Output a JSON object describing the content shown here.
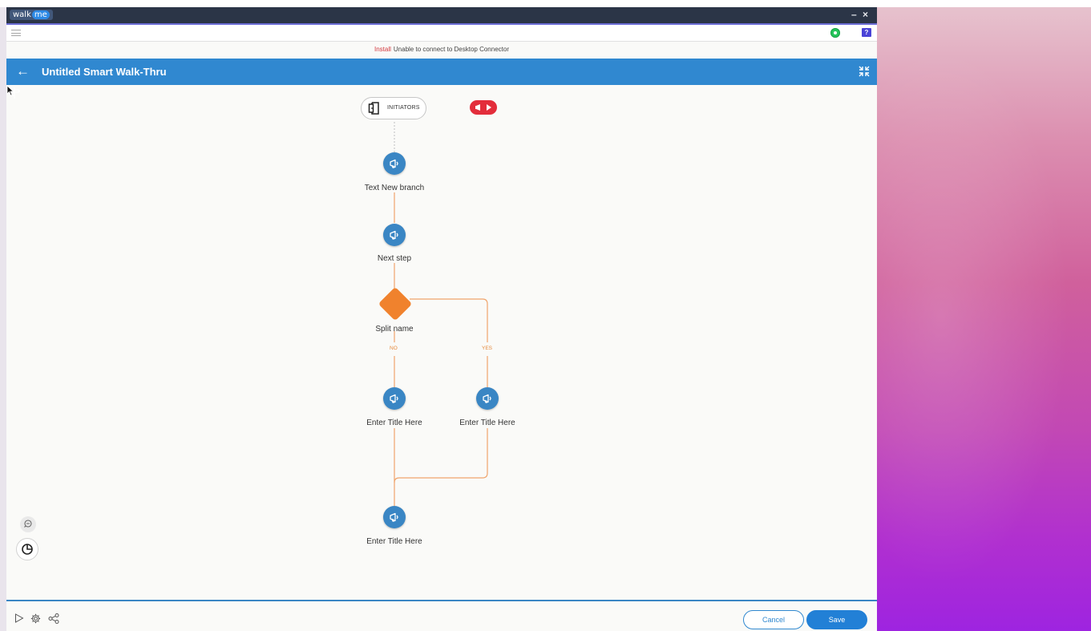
{
  "app": {
    "logo_text": "walk",
    "logo_badge": "me",
    "minimize": "–",
    "close": "×",
    "help": "?"
  },
  "notice": {
    "install_link": "Install",
    "message": "Unable to connect to Desktop Connector"
  },
  "header": {
    "back": "←",
    "title": "Untitled Smart Walk-Thru"
  },
  "flow": {
    "initiators_label": "INITIATORS",
    "steps": [
      {
        "label": "Text New branch"
      },
      {
        "label": "Next step"
      },
      {
        "label": "Split name"
      },
      {
        "label": "Enter Title Here"
      },
      {
        "label": "Enter Title Here"
      },
      {
        "label": "Enter Title Here"
      }
    ],
    "branch_no": "NO",
    "branch_yes": "YES"
  },
  "footer": {
    "cancel_label": "Cancel",
    "save_label": "Save"
  },
  "colors": {
    "header": "#3088d0",
    "node": "#3a86c4",
    "split": "#f0822d",
    "connector": "#f0a46c",
    "launch_badge": "#e32d3b"
  }
}
